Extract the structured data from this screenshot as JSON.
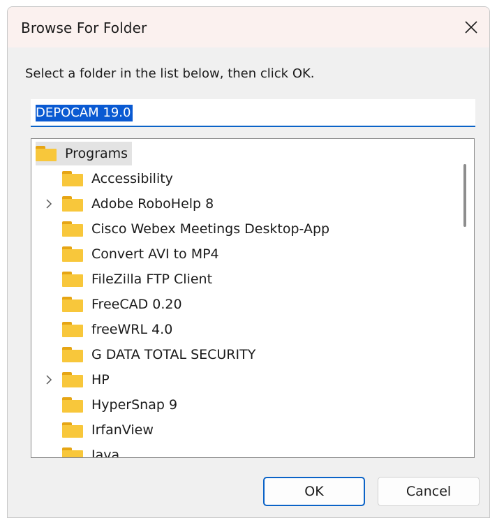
{
  "dialog": {
    "title": "Browse For Folder",
    "instruction": "Select a folder in the list below, then click OK.",
    "folder_field_value": "DEPOCAM 19.0",
    "ok_label": "OK",
    "cancel_label": "Cancel"
  },
  "tree": {
    "root": {
      "label": "Programs",
      "icon": "folder-icon"
    },
    "items": [
      {
        "label": "Accessibility",
        "expandable": false
      },
      {
        "label": "Adobe RoboHelp 8",
        "expandable": true
      },
      {
        "label": "Cisco Webex Meetings Desktop-App",
        "expandable": false
      },
      {
        "label": "Convert AVI to MP4",
        "expandable": false
      },
      {
        "label": "FileZilla FTP Client",
        "expandable": false
      },
      {
        "label": "FreeCAD 0.20",
        "expandable": false
      },
      {
        "label": "freeWRL 4.0",
        "expandable": false
      },
      {
        "label": "G DATA TOTAL SECURITY",
        "expandable": false
      },
      {
        "label": "HP",
        "expandable": true
      },
      {
        "label": "HyperSnap 9",
        "expandable": false
      },
      {
        "label": "IrfanView",
        "expandable": false
      },
      {
        "label": "Java",
        "expandable": false
      }
    ]
  },
  "colors": {
    "title_bg": "#fbf1ef",
    "dialog_bg": "#f0f0f0",
    "accent": "#0b63c7",
    "selection": "#0a5ad2",
    "folder": "#f8c73b"
  }
}
